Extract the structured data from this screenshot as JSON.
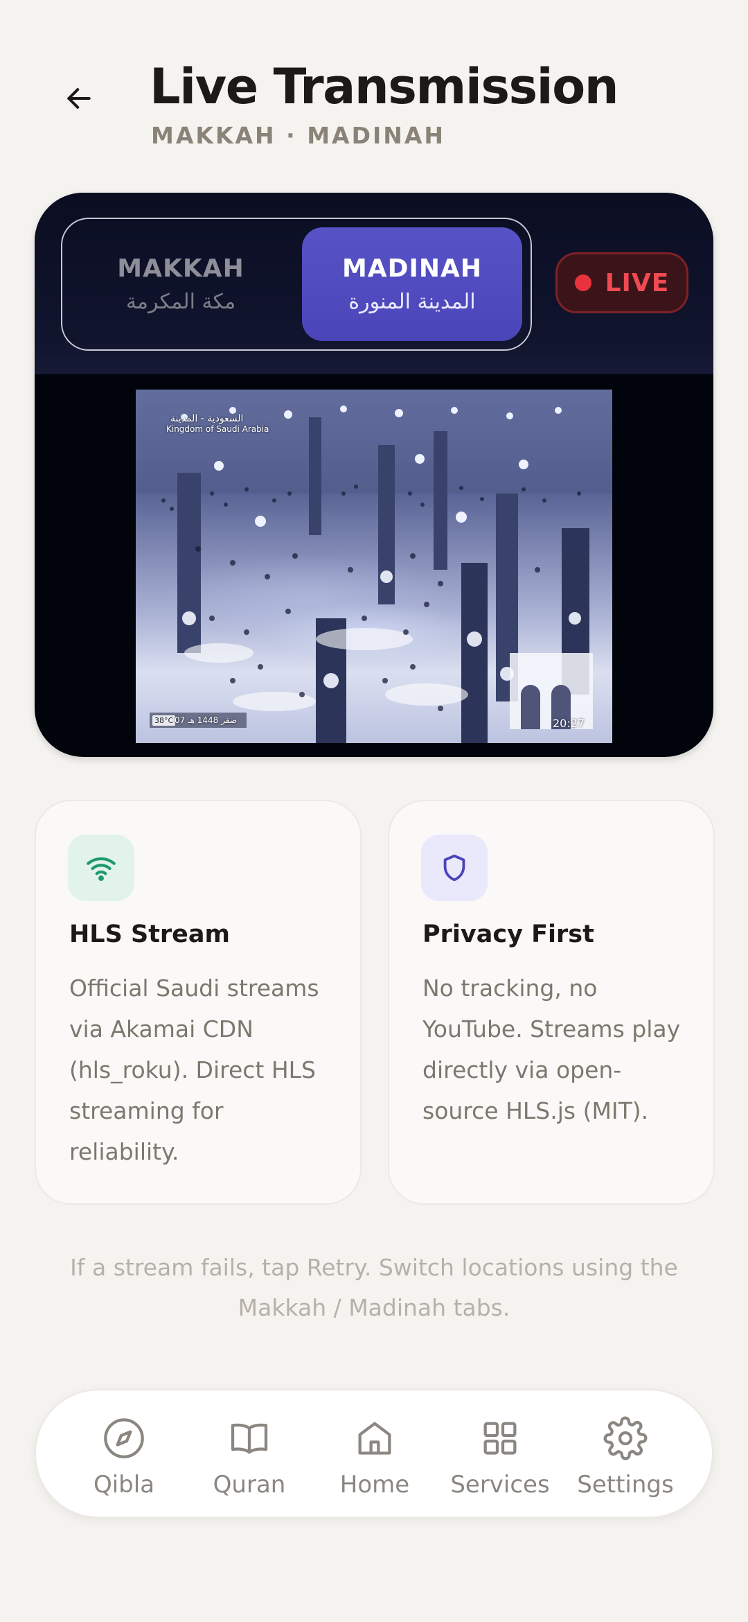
{
  "header": {
    "title": "Live Transmission",
    "subtitle": "MAKKAH · MADINAH"
  },
  "player": {
    "tabs": [
      {
        "label": "MAKKAH",
        "label_ar": "مكة المكرمة",
        "selected": false
      },
      {
        "label": "MADINAH",
        "label_ar": "المدينة المنورة",
        "selected": true
      }
    ],
    "live_label": "LIVE",
    "overlay": {
      "channel_ar": "السعودية - المدينة",
      "country": "Kingdom of Saudi Arabia",
      "temperature": "38°C",
      "hijri_date": "07 صفر 1448 هـ",
      "time": "20:27"
    }
  },
  "cards": [
    {
      "icon": "wifi-icon",
      "title": "HLS Stream",
      "body": "Official Saudi streams via Akamai CDN (hls_roku). Direct HLS streaming for reliability."
    },
    {
      "icon": "shield-icon",
      "title": "Privacy First",
      "body": "No tracking, no YouTube. Streams play directly via open-source HLS.js (MIT)."
    }
  ],
  "hint": "If a stream fails, tap Retry. Switch locations using the Makkah / Madinah tabs.",
  "nav": {
    "items": [
      {
        "label": "Qibla",
        "icon": "compass-icon"
      },
      {
        "label": "Quran",
        "icon": "book-icon"
      },
      {
        "label": "Home",
        "icon": "home-icon"
      },
      {
        "label": "Services",
        "icon": "grid-icon"
      },
      {
        "label": "Settings",
        "icon": "gear-icon"
      }
    ]
  },
  "colors": {
    "background": "#f5f3ef",
    "accent": "#5753c7",
    "live_red": "#f04a52",
    "wifi_green": "#1e9a6a",
    "shield_indigo": "#4a45b8"
  }
}
